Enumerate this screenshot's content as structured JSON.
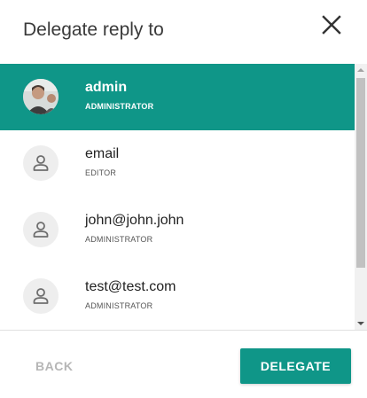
{
  "dialog": {
    "title": "Delegate reply to",
    "close_icon": "close-icon"
  },
  "users": [
    {
      "name": "admin",
      "role": "ADMINISTRATOR",
      "selected": true,
      "avatar": "photo"
    },
    {
      "name": "email",
      "role": "EDITOR",
      "selected": false,
      "avatar": "person-icon"
    },
    {
      "name": "john@john.john",
      "role": "ADMINISTRATOR",
      "selected": false,
      "avatar": "person-icon"
    },
    {
      "name": "test@test.com",
      "role": "ADMINISTRATOR",
      "selected": false,
      "avatar": "person-icon"
    }
  ],
  "footer": {
    "back_label": "BACK",
    "delegate_label": "DELEGATE"
  },
  "colors": {
    "accent": "#0f9688",
    "disabled_text": "#b6b6b6"
  }
}
